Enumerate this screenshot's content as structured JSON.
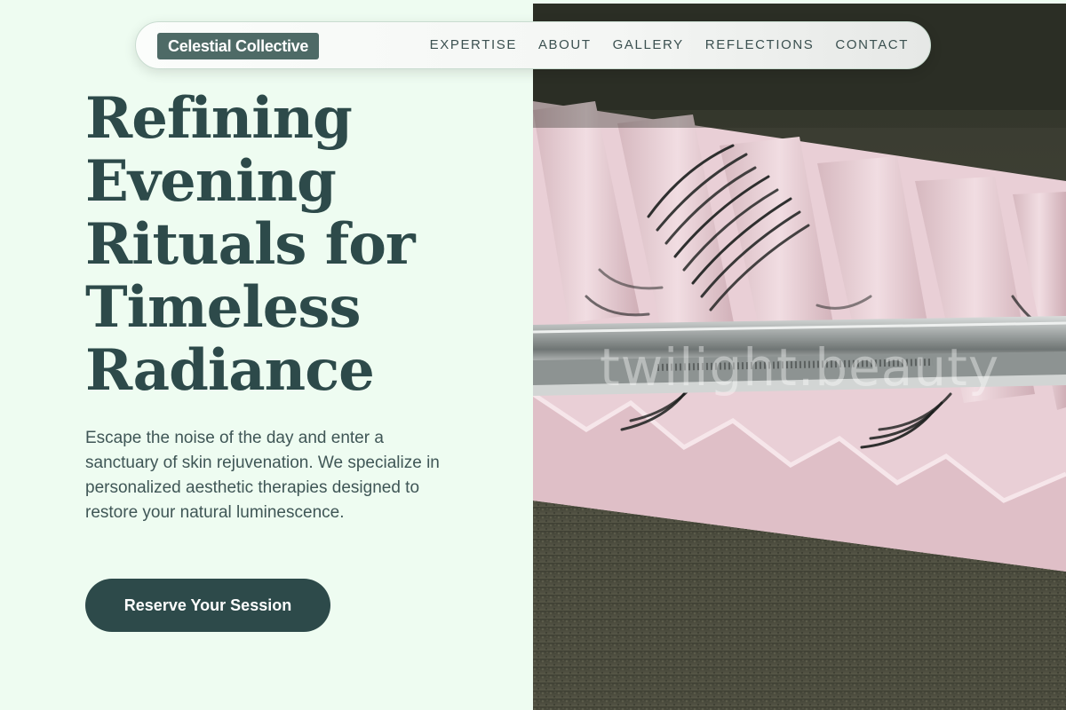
{
  "brand": {
    "name": "Celestial Collective"
  },
  "nav": {
    "items": [
      {
        "label": "EXPERTISE"
      },
      {
        "label": "ABOUT"
      },
      {
        "label": "GALLERY"
      },
      {
        "label": "REFLECTIONS"
      },
      {
        "label": "CONTACT"
      }
    ]
  },
  "hero": {
    "headline_lines": [
      "Refining",
      "Evening",
      "Rituals for",
      "Timeless",
      "Radiance"
    ],
    "intro": "Escape the noise of the day and enter a sanctuary of skin rejuvenation. We specialize in personalized aesthetic therapies designed to restore your natural luminescence.",
    "cta_label": "Reserve Your Session"
  },
  "photo": {
    "subject": "eyelash-extension-tray-with-tweezers",
    "watermark": "twilight.beauty"
  },
  "colors": {
    "page_background": "#eefcf1",
    "primary": "#2d4a4a",
    "logo_background": "#4e6a66",
    "body_text": "#3f5656"
  }
}
